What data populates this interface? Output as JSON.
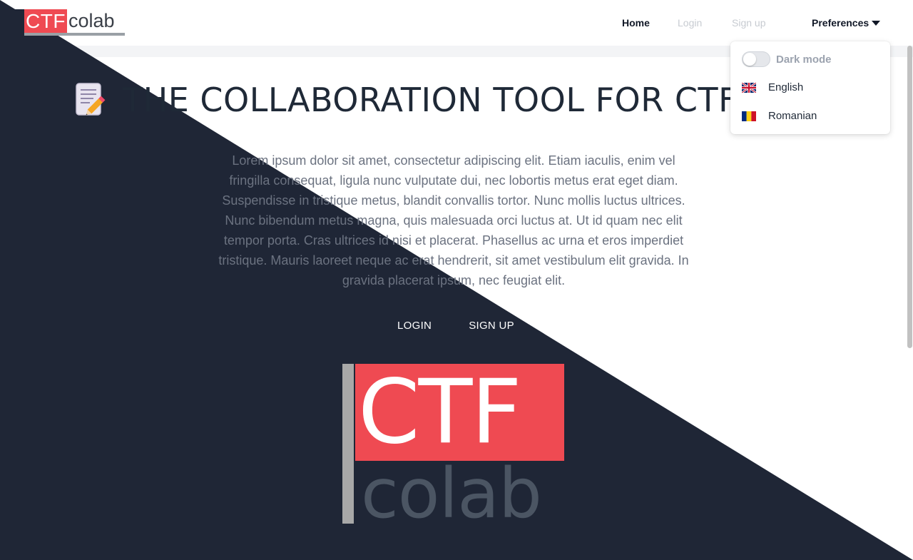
{
  "brand": {
    "ctf": "CTF",
    "colab": "colab"
  },
  "nav": {
    "home": "Home",
    "login": "Login",
    "signup": "Sign up",
    "preferences": "Preferences"
  },
  "preferences_menu": {
    "dark_mode_label": "Dark mode",
    "dark_mode_on": false,
    "languages": [
      {
        "label": "English",
        "flag": "uk-flag-icon"
      },
      {
        "label": "Romanian",
        "flag": "romania-flag-icon"
      }
    ]
  },
  "hero": {
    "title": "THE COLLABORATION TOOL FOR CTF TEAMS",
    "description": "Lorem ipsum dolor sit amet, consectetur adipiscing elit. Etiam iaculis, enim vel fringilla consequat, ligula nunc vulputate dui, nec lobortis metus erat eget diam. Suspendisse in tristique metus, blandit convallis tortor. Nunc mollis luctus ultrices. Nunc bibendum metus magna, quis malesuada orci luctus at. Ut id quam nec elit tempor porta. Cras ultrices id nisi et placerat. Phasellus ac urna et eros imperdiet tristique. Mauris laoreet neque ac erat hendrerit, sit amet vestibulum elit gravida. In gravida placerat ipsum, nec feugiat elit.",
    "login_button": "LOGIN",
    "signup_button": "SIGN UP"
  },
  "logo_large": {
    "ctf": "CTF",
    "colab": "colab"
  },
  "colors": {
    "accent_red": "#ef4a52",
    "dark_navy": "#1f2636",
    "white": "#ffffff"
  }
}
